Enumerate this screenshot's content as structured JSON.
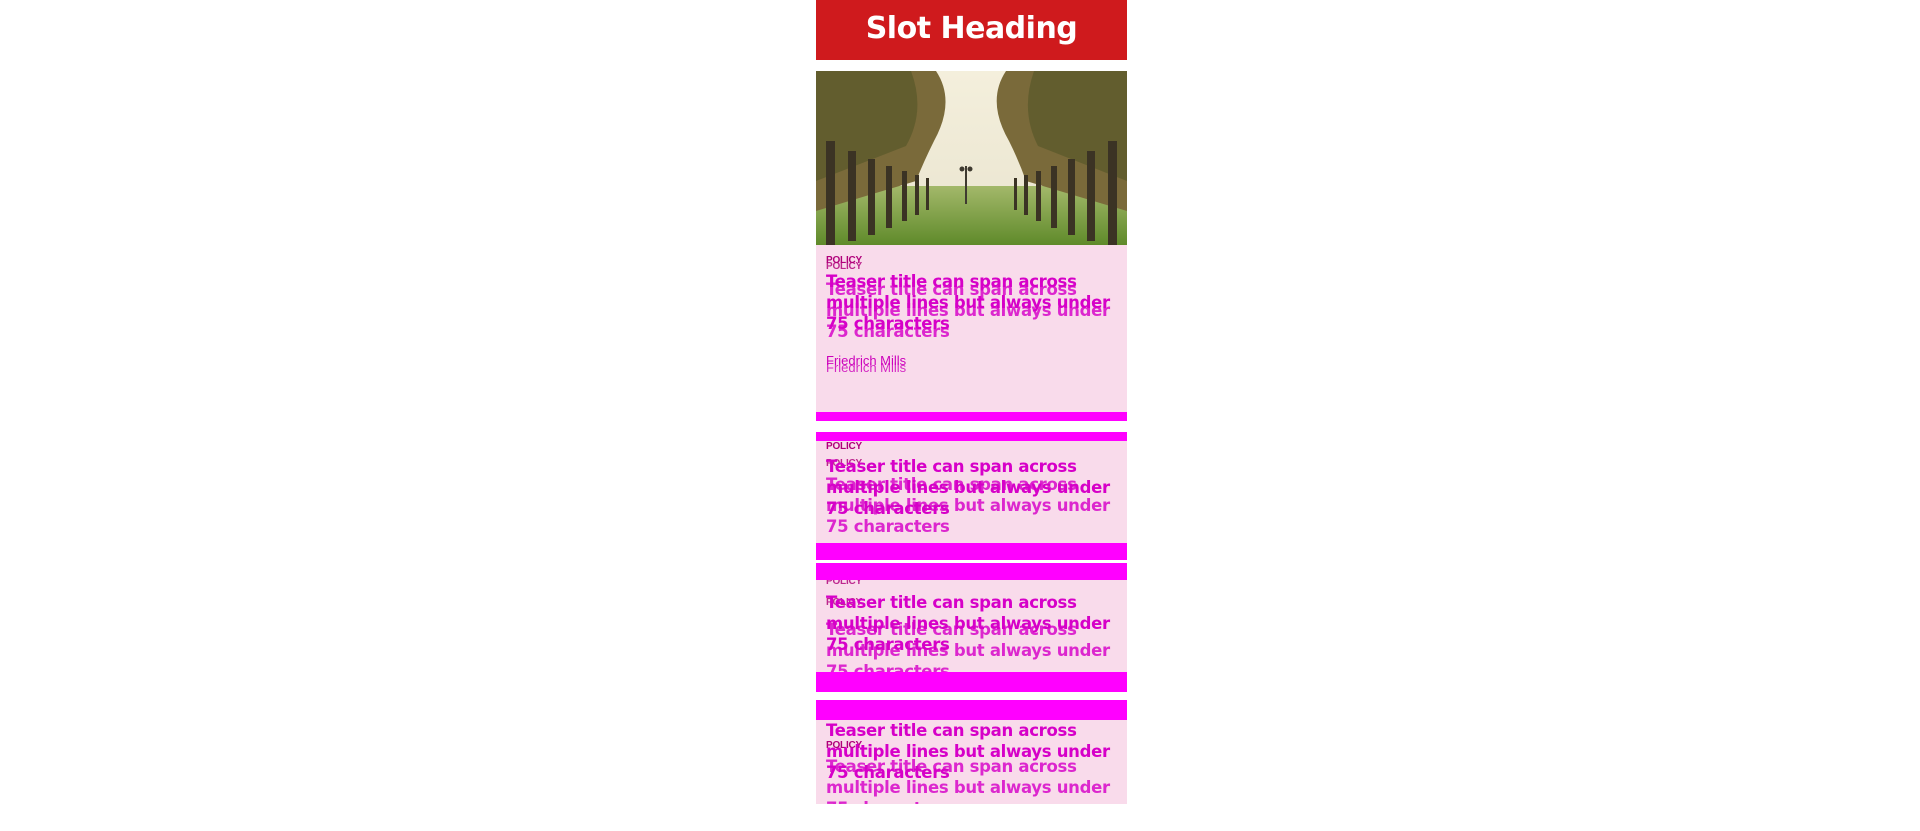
{
  "slot": {
    "heading": "Slot Heading"
  },
  "hero": {
    "alt": "Palm-lined avenue"
  },
  "teasers": [
    {
      "category": "POLICY",
      "title": "Teaser title can span across multiple lines but always under 75 characters",
      "author": "Friedrich Mills"
    },
    {
      "category": "POLICY",
      "title": "Teaser title can span across multiple lines but always under 75 characters"
    },
    {
      "category": "POLICY",
      "title": "Teaser title can span across multiple lines but always under 75 characters"
    },
    {
      "category": "POLICY",
      "title": "Teaser title can span across multiple lines but always under 75 characters"
    }
  ],
  "colors": {
    "heading_bg": "#cf1a1d",
    "card_bg": "#f9dbeb",
    "accent": "#ff00ff"
  }
}
